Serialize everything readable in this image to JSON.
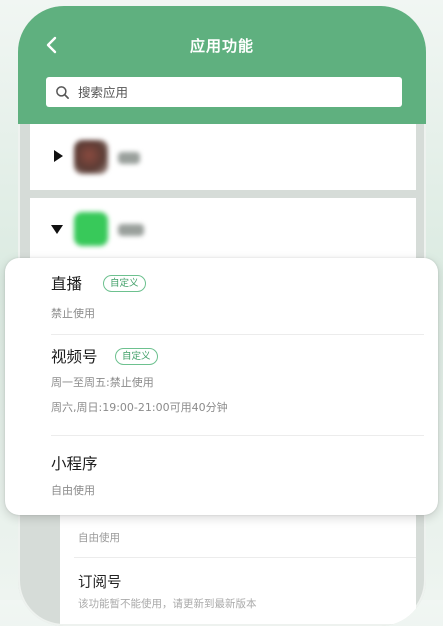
{
  "header": {
    "back_icon": "chevron-left-icon",
    "title": "应用功能",
    "accent_color": "#5fb07f"
  },
  "search": {
    "icon": "search-icon",
    "placeholder": "搜索应用"
  },
  "app_list": [
    {
      "icon": "app-icon",
      "expanded": false,
      "name": ""
    },
    {
      "icon": "wechat-icon",
      "expanded": true,
      "name": ""
    }
  ],
  "popup": {
    "items": [
      {
        "title": "直播",
        "badge": "自定义",
        "lines": [
          "禁止使用"
        ]
      },
      {
        "title": "视频号",
        "badge": "自定义",
        "lines": [
          "周一至周五:禁止使用",
          "周六,周日:19:00-21:00可用40分钟"
        ]
      },
      {
        "title": "小程序",
        "badge": "",
        "lines": [
          "自由使用"
        ]
      }
    ]
  },
  "lower_list": {
    "first_status": "自由使用",
    "second_title": "订阅号",
    "second_status": "该功能暂不能使用，请更新到最新版本"
  }
}
